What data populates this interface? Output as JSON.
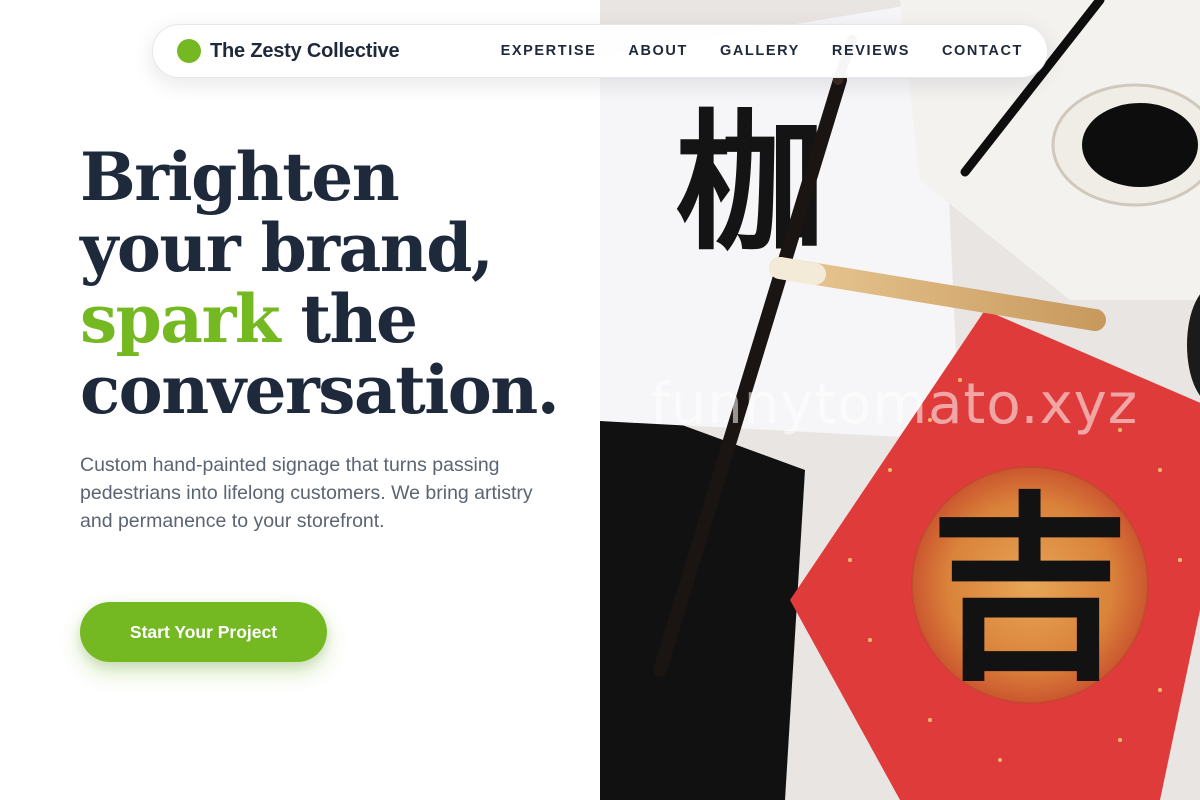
{
  "nav": {
    "brand": "The Zesty Collective",
    "items": [
      {
        "label": "EXPERTISE"
      },
      {
        "label": "ABOUT"
      },
      {
        "label": "GALLERY"
      },
      {
        "label": "REVIEWS"
      },
      {
        "label": "CONTACT"
      }
    ]
  },
  "hero": {
    "headline_line1": "Brighten",
    "headline_line2": "your brand,",
    "headline_accent": "spark",
    "headline_line3_rest": " the",
    "headline_line4": "conversation.",
    "lede": "Custom hand-painted signage that turns passing pedestrians into lifelong customers. We bring artistry and permanence to your storefront.",
    "cta_label": "Start Your Project"
  },
  "photo": {
    "watermark": "funnytomato.xyz",
    "glyph_top": "枷",
    "glyph_main": "吉"
  },
  "colors": {
    "accent": "#74b922",
    "ink": "#1e293b",
    "muted": "#5b6472",
    "paper_red": "#e03b3b"
  }
}
